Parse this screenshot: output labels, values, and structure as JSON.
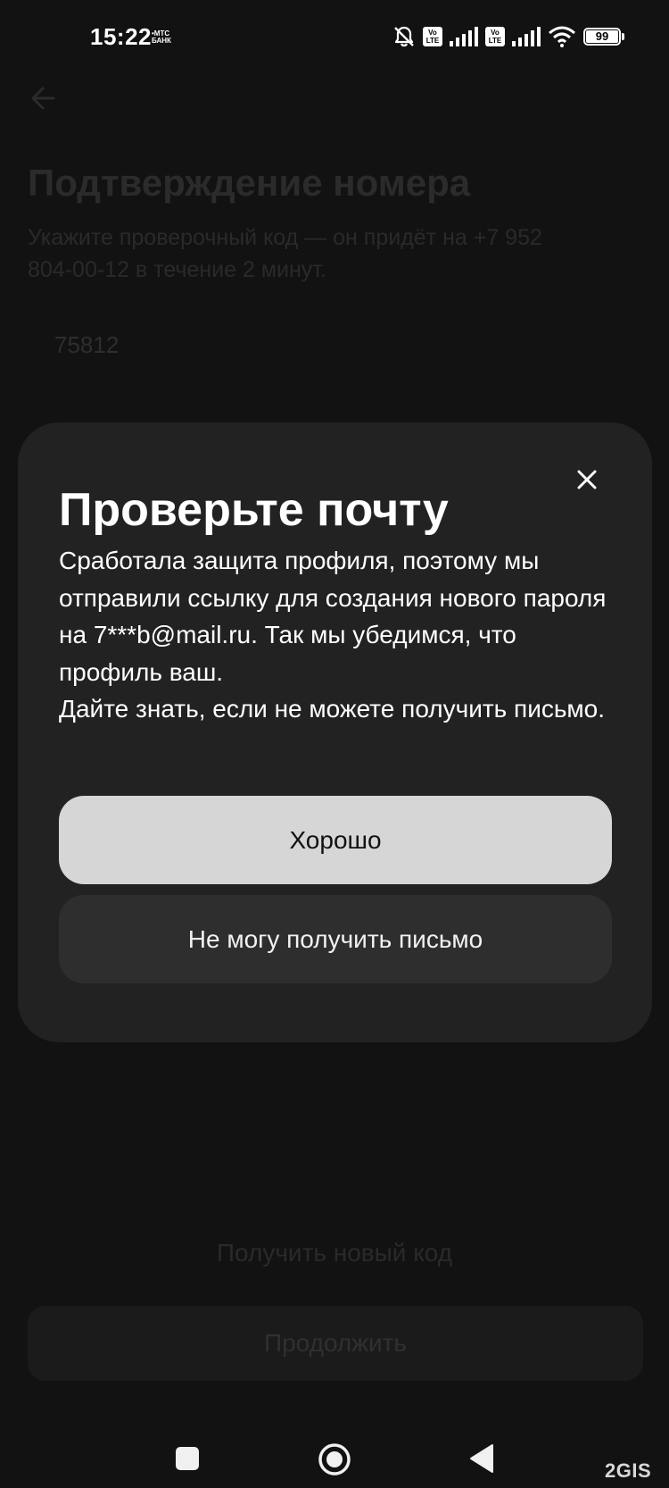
{
  "status_bar": {
    "time": "15:22",
    "carrier_line1": "•МТС",
    "carrier_line2": "БАНК",
    "volte_label": "Vo LTE",
    "battery_level": "99",
    "icons": [
      "bell-off-icon",
      "volte-icon",
      "signal-icon",
      "volte-icon",
      "signal-icon",
      "wifi-icon",
      "battery-icon"
    ]
  },
  "background_page": {
    "back_icon": "arrow-left-icon",
    "title": "Подтверждение номера",
    "subtitle": "Укажите проверочный код — он придёт на +7 952 804-00-12 в течение 2 минут.",
    "code_value": "75812",
    "new_code_link": "Получить новый код",
    "continue_button": "Продолжить"
  },
  "modal": {
    "close_icon": "close-icon",
    "title": "Проверьте почту",
    "paragraph1": "Сработала защита профиля, поэтому мы отправили ссылку для создания нового пароля на 7***b@mail.ru. Так мы убедимся, что профиль ваш.",
    "paragraph2": "Дайте знать, если не можете получить письмо.",
    "ok_button": "Хорошо",
    "cant_receive_button": "Не могу получить письмо"
  },
  "nav_bar": {
    "icons": [
      "recent-apps-icon",
      "home-icon",
      "back-icon"
    ],
    "watermark": "2GIS"
  },
  "colors": {
    "background": "#121212",
    "modal": "#222222",
    "primary_button": "#d6d6d6",
    "secondary_button": "#2e2e2e"
  }
}
